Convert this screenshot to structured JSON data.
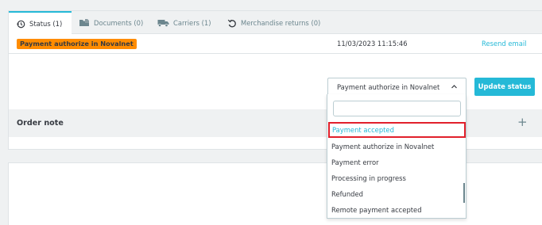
{
  "tabs": [
    {
      "label": "Status (1)",
      "icon": "history-icon"
    },
    {
      "label": "Documents (0)",
      "icon": "document-icon"
    },
    {
      "label": "Carriers (1)",
      "icon": "truck-icon"
    },
    {
      "label": "Merchandise returns (0)",
      "icon": "undo-icon"
    }
  ],
  "status": {
    "badge_label": "Payment authorize in Novalnet",
    "badge_color": "#ff8c00",
    "date": "11/03/2023 11:15:46",
    "resend_label": "Resend email"
  },
  "status_select": {
    "value": "Payment authorize in Novalnet",
    "update_label": "Update status"
  },
  "order_note": {
    "title": "Order note",
    "expand_symbol": "+"
  },
  "dropdown": {
    "search_value": "",
    "options": [
      "Payment accepted",
      "Payment authorize in Novalnet",
      "Payment error",
      "Processing in progress",
      "Refunded",
      "Remote payment accepted"
    ],
    "highlighted": "Payment accepted"
  },
  "colors": {
    "accent": "#25b9d7",
    "highlight_border": "#e1202b",
    "badge": "#ff8c00"
  }
}
